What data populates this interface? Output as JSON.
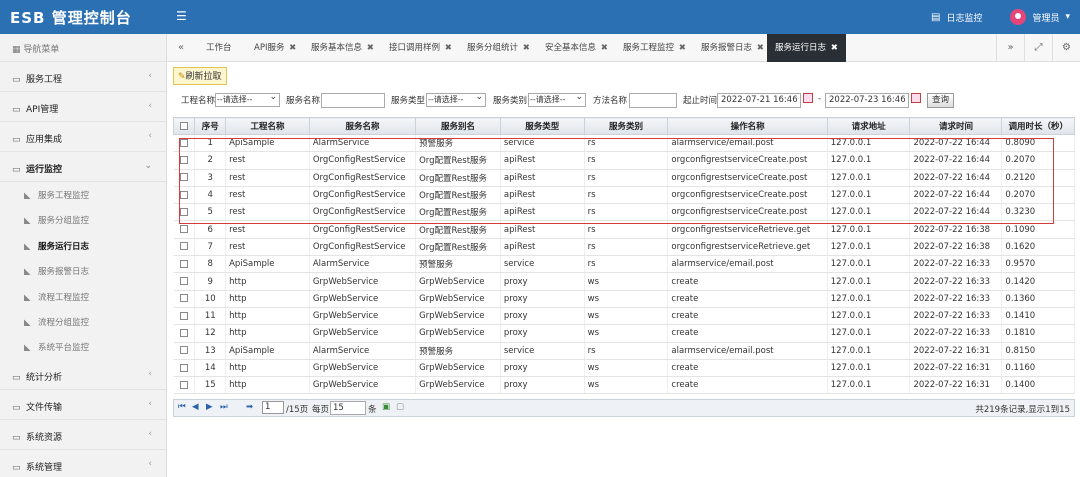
{
  "app": {
    "brand": "ESB 管理控制台",
    "menu_icon": "hamburger-icon",
    "log_monitor": "日志监控",
    "user": "管理员",
    "user_caret": "▾"
  },
  "sidebar": {
    "header": "导航菜单",
    "groups_top": [
      {
        "label": "服务工程"
      },
      {
        "label": "API管理"
      },
      {
        "label": "应用集成"
      },
      {
        "label": "运行监控"
      }
    ],
    "subitems": [
      {
        "label": "服务工程监控"
      },
      {
        "label": "服务分组监控"
      },
      {
        "label": "服务运行日志"
      },
      {
        "label": "服务报警日志"
      },
      {
        "label": "流程工程监控"
      },
      {
        "label": "流程分组监控"
      },
      {
        "label": "系统平台监控"
      }
    ],
    "groups_bottom": [
      {
        "label": "统计分析"
      },
      {
        "label": "文件传输"
      },
      {
        "label": "系统资源"
      },
      {
        "label": "系统管理"
      }
    ]
  },
  "tabs": [
    {
      "label": "工作台",
      "close": ""
    },
    {
      "label": "API服务",
      "close": "✖"
    },
    {
      "label": "服务基本信息",
      "close": "✖"
    },
    {
      "label": "接口调用样例",
      "close": "✖"
    },
    {
      "label": "服务分组统计",
      "close": "✖"
    },
    {
      "label": "安全基本信息",
      "close": "✖"
    },
    {
      "label": "服务工程监控",
      "close": "✖"
    },
    {
      "label": "服务报警日志",
      "close": "✖"
    },
    {
      "label": "服务运行日志",
      "close": "✖"
    }
  ],
  "toolbar": {
    "refresh": "刷新拉取"
  },
  "filters": {
    "project_label": "工程名称",
    "project_value": "--请选择--",
    "service_label": "服务名称",
    "service_value": "",
    "stype_label": "服务类型",
    "stype_value": "--请选择--",
    "scat_label": "服务类别",
    "scat_value": "--请选择--",
    "method_label": "方法名称",
    "method_value": "",
    "time_label": "起止时间",
    "start": "2022-07-21 16:46",
    "dash": "-",
    "end": "2022-07-23 16:46",
    "query": "查询"
  },
  "table": {
    "columns": [
      "序号",
      "工程名称",
      "服务名称",
      "服务别名",
      "服务类型",
      "服务类别",
      "操作名称",
      "请求地址",
      "请求时间",
      "调用时长（秒）"
    ],
    "rows": [
      [
        "1",
        "ApiSample",
        "AlarmService",
        "预警服务",
        "service",
        "rs",
        "alarmservice/email.post",
        "127.0.0.1",
        "2022-07-22 16:44",
        "0.8090"
      ],
      [
        "2",
        "rest",
        "OrgConfigRestService",
        "Org配置Rest服务",
        "apiRest",
        "rs",
        "orgconfigrestserviceCreate.post",
        "127.0.0.1",
        "2022-07-22 16:44",
        "0.2070"
      ],
      [
        "3",
        "rest",
        "OrgConfigRestService",
        "Org配置Rest服务",
        "apiRest",
        "rs",
        "orgconfigrestserviceCreate.post",
        "127.0.0.1",
        "2022-07-22 16:44",
        "0.2120"
      ],
      [
        "4",
        "rest",
        "OrgConfigRestService",
        "Org配置Rest服务",
        "apiRest",
        "rs",
        "orgconfigrestserviceCreate.post",
        "127.0.0.1",
        "2022-07-22 16:44",
        "0.2070"
      ],
      [
        "5",
        "rest",
        "OrgConfigRestService",
        "Org配置Rest服务",
        "apiRest",
        "rs",
        "orgconfigrestserviceCreate.post",
        "127.0.0.1",
        "2022-07-22 16:44",
        "0.3230"
      ],
      [
        "6",
        "rest",
        "OrgConfigRestService",
        "Org配置Rest服务",
        "apiRest",
        "rs",
        "orgconfigrestserviceRetrieve.get",
        "127.0.0.1",
        "2022-07-22 16:38",
        "0.1090"
      ],
      [
        "7",
        "rest",
        "OrgConfigRestService",
        "Org配置Rest服务",
        "apiRest",
        "rs",
        "orgconfigrestserviceRetrieve.get",
        "127.0.0.1",
        "2022-07-22 16:38",
        "0.1620"
      ],
      [
        "8",
        "ApiSample",
        "AlarmService",
        "预警服务",
        "service",
        "rs",
        "alarmservice/email.post",
        "127.0.0.1",
        "2022-07-22 16:33",
        "0.9570"
      ],
      [
        "9",
        "http",
        "GrpWebService",
        "GrpWebService",
        "proxy",
        "ws",
        "create",
        "127.0.0.1",
        "2022-07-22 16:33",
        "0.1420"
      ],
      [
        "10",
        "http",
        "GrpWebService",
        "GrpWebService",
        "proxy",
        "ws",
        "create",
        "127.0.0.1",
        "2022-07-22 16:33",
        "0.1360"
      ],
      [
        "11",
        "http",
        "GrpWebService",
        "GrpWebService",
        "proxy",
        "ws",
        "create",
        "127.0.0.1",
        "2022-07-22 16:33",
        "0.1410"
      ],
      [
        "12",
        "http",
        "GrpWebService",
        "GrpWebService",
        "proxy",
        "ws",
        "create",
        "127.0.0.1",
        "2022-07-22 16:33",
        "0.1810"
      ],
      [
        "13",
        "ApiSample",
        "AlarmService",
        "预警服务",
        "service",
        "rs",
        "alarmservice/email.post",
        "127.0.0.1",
        "2022-07-22 16:31",
        "0.8150"
      ],
      [
        "14",
        "http",
        "GrpWebService",
        "GrpWebService",
        "proxy",
        "ws",
        "create",
        "127.0.0.1",
        "2022-07-22 16:31",
        "0.1160"
      ],
      [
        "15",
        "http",
        "GrpWebService",
        "GrpWebService",
        "proxy",
        "ws",
        "create",
        "127.0.0.1",
        "2022-07-22 16:31",
        "0.1400"
      ]
    ]
  },
  "pager": {
    "page": "1",
    "total_pages": "/15页",
    "per_page_label": "每页",
    "per_page": "15",
    "unit": "条",
    "info": "共219条记录,显示1到15"
  },
  "colors": {
    "topbar": "#2c70b4",
    "highlight": "#d63c3c",
    "active_tab": "#2a2f35"
  }
}
